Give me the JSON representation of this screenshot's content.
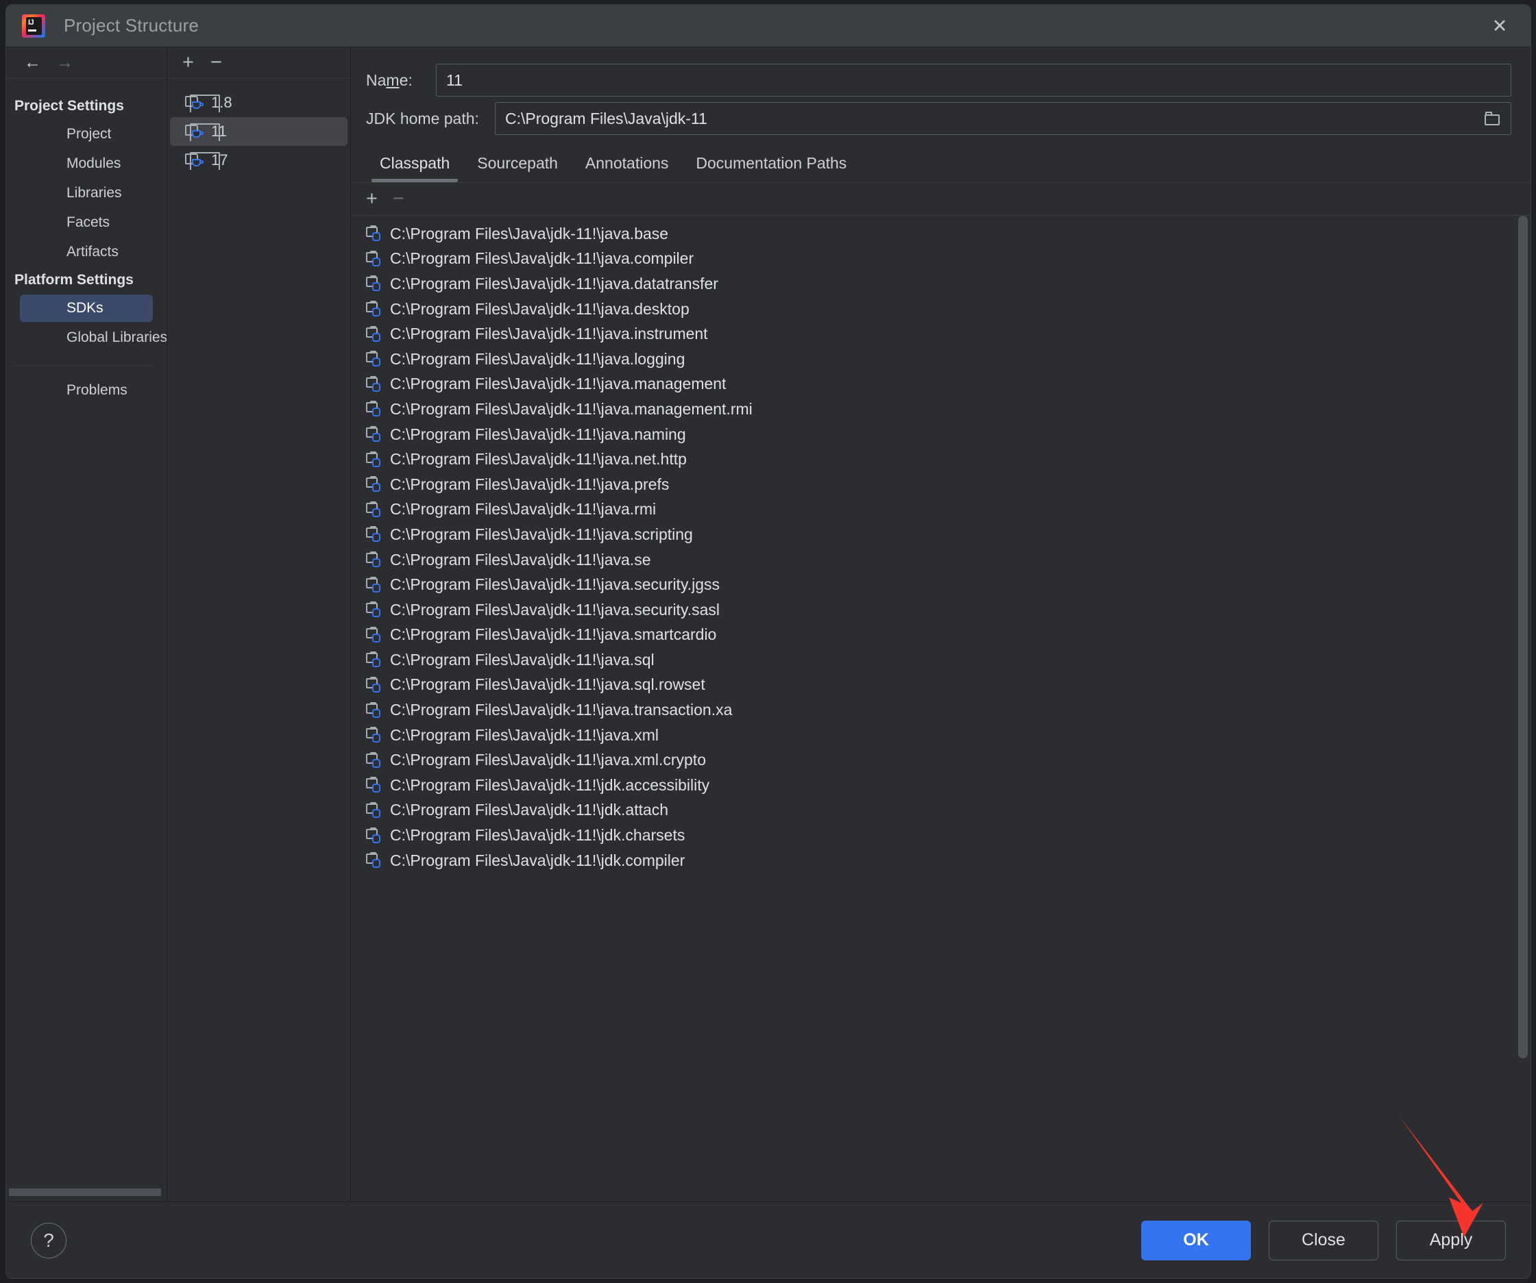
{
  "window": {
    "title": "Project Structure",
    "logo_icon": "intellij-idea-logo",
    "close_icon": "close-icon"
  },
  "sidebar": {
    "back_icon": "arrow-left-icon",
    "forward_icon": "arrow-right-icon",
    "groups": [
      {
        "header": "Project Settings",
        "items": [
          {
            "label": "Project",
            "selected": false
          },
          {
            "label": "Modules",
            "selected": false
          },
          {
            "label": "Libraries",
            "selected": false
          },
          {
            "label": "Facets",
            "selected": false
          },
          {
            "label": "Artifacts",
            "selected": false
          }
        ]
      },
      {
        "header": "Platform Settings",
        "items": [
          {
            "label": "SDKs",
            "selected": true
          },
          {
            "label": "Global Libraries",
            "selected": false
          }
        ]
      }
    ],
    "extra_items": [
      {
        "label": "Problems",
        "selected": false
      }
    ]
  },
  "sdk_list": {
    "add_icon": "plus-icon",
    "remove_icon": "minus-icon",
    "items": [
      {
        "label": "1.8",
        "icon": "jdk-folder-icon",
        "selected": false
      },
      {
        "label": "11",
        "icon": "jdk-folder-icon",
        "selected": true
      },
      {
        "label": "17",
        "icon": "jdk-folder-icon",
        "selected": false
      }
    ]
  },
  "detail": {
    "name_label_prefix": "Na",
    "name_label_mnemonic": "m",
    "name_label_suffix": "e:",
    "name_value": "11",
    "home_label": "JDK home path:",
    "home_value": "C:\\Program Files\\Java\\jdk-11",
    "browse_icon": "folder-browse-icon",
    "tabs": [
      {
        "label": "Classpath",
        "active": true
      },
      {
        "label": "Sourcepath",
        "active": false
      },
      {
        "label": "Annotations",
        "active": false
      },
      {
        "label": "Documentation Paths",
        "active": false
      }
    ],
    "list_toolbar": {
      "add_icon": "plus-icon",
      "remove_icon": "minus-icon"
    },
    "classpath_entries": [
      "C:\\Program Files\\Java\\jdk-11!\\java.base",
      "C:\\Program Files\\Java\\jdk-11!\\java.compiler",
      "C:\\Program Files\\Java\\jdk-11!\\java.datatransfer",
      "C:\\Program Files\\Java\\jdk-11!\\java.desktop",
      "C:\\Program Files\\Java\\jdk-11!\\java.instrument",
      "C:\\Program Files\\Java\\jdk-11!\\java.logging",
      "C:\\Program Files\\Java\\jdk-11!\\java.management",
      "C:\\Program Files\\Java\\jdk-11!\\java.management.rmi",
      "C:\\Program Files\\Java\\jdk-11!\\java.naming",
      "C:\\Program Files\\Java\\jdk-11!\\java.net.http",
      "C:\\Program Files\\Java\\jdk-11!\\java.prefs",
      "C:\\Program Files\\Java\\jdk-11!\\java.rmi",
      "C:\\Program Files\\Java\\jdk-11!\\java.scripting",
      "C:\\Program Files\\Java\\jdk-11!\\java.se",
      "C:\\Program Files\\Java\\jdk-11!\\java.security.jgss",
      "C:\\Program Files\\Java\\jdk-11!\\java.security.sasl",
      "C:\\Program Files\\Java\\jdk-11!\\java.smartcardio",
      "C:\\Program Files\\Java\\jdk-11!\\java.sql",
      "C:\\Program Files\\Java\\jdk-11!\\java.sql.rowset",
      "C:\\Program Files\\Java\\jdk-11!\\java.transaction.xa",
      "C:\\Program Files\\Java\\jdk-11!\\java.xml",
      "C:\\Program Files\\Java\\jdk-11!\\java.xml.crypto",
      "C:\\Program Files\\Java\\jdk-11!\\jdk.accessibility",
      "C:\\Program Files\\Java\\jdk-11!\\jdk.attach",
      "C:\\Program Files\\Java\\jdk-11!\\jdk.charsets",
      "C:\\Program Files\\Java\\jdk-11!\\jdk.compiler"
    ]
  },
  "footer": {
    "help_label": "?",
    "ok_label": "OK",
    "close_label": "Close",
    "apply_label": "Apply"
  },
  "annotation": {
    "arrow_color": "#f5342b",
    "points_to": "Apply"
  },
  "colors": {
    "accent_blue": "#3574f0",
    "selection_blue": "#3b4a6b",
    "dialog_bg": "#2b2d30",
    "titlebar_bg": "#3c3f41",
    "annotation_red": "#f5342b"
  }
}
